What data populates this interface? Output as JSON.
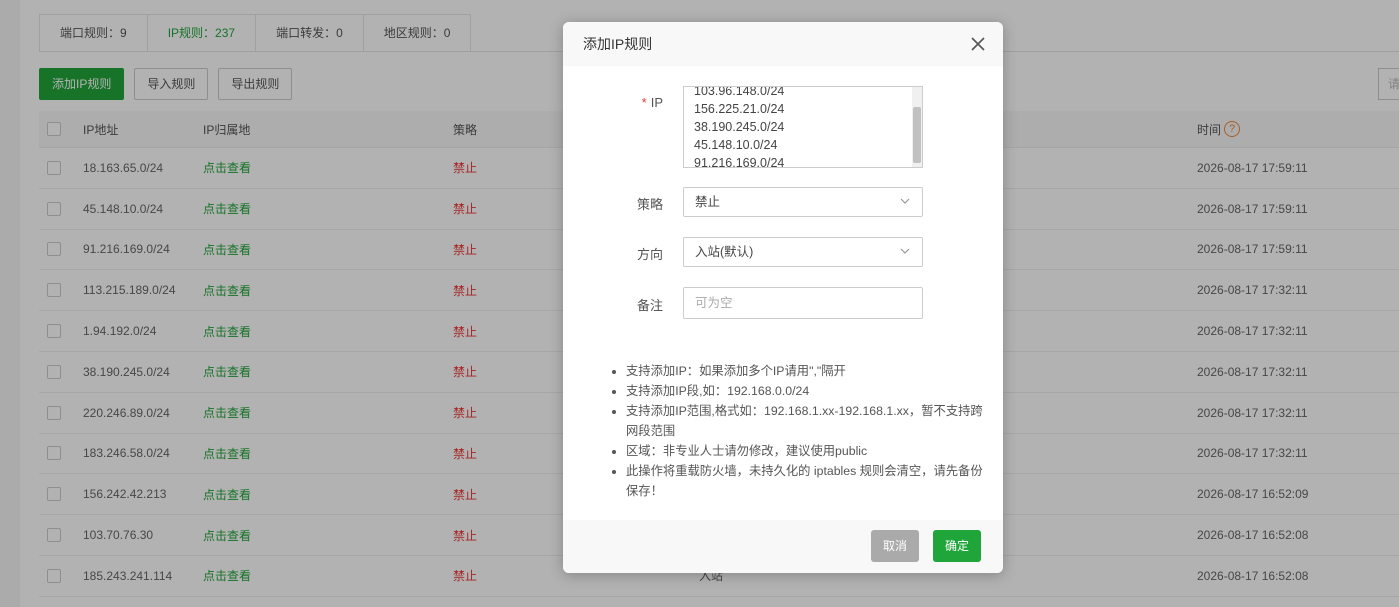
{
  "tabs": [
    {
      "label": "端口规则：9"
    },
    {
      "label": "IP规则：237"
    },
    {
      "label": "端口转发：0"
    },
    {
      "label": "地区规则：0"
    }
  ],
  "toolbar": {
    "add_label": "添加IP规则",
    "import_label": "导入规则",
    "export_label": "导出规则",
    "search_stub": "请"
  },
  "table": {
    "headers": {
      "ip": "IP地址",
      "location": "IP归属地",
      "policy": "策略",
      "time": "时间"
    },
    "rows": [
      {
        "ip": "18.163.65.0/24",
        "location": "点击查看",
        "policy": "禁止",
        "direction": "",
        "time": "2026-08-17 17:59:11"
      },
      {
        "ip": "45.148.10.0/24",
        "location": "点击查看",
        "policy": "禁止",
        "direction": "",
        "time": "2026-08-17 17:59:11"
      },
      {
        "ip": "91.216.169.0/24",
        "location": "点击查看",
        "policy": "禁止",
        "direction": "",
        "time": "2026-08-17 17:59:11"
      },
      {
        "ip": "113.215.189.0/24",
        "location": "点击查看",
        "policy": "禁止",
        "direction": "",
        "time": "2026-08-17 17:32:11"
      },
      {
        "ip": "1.94.192.0/24",
        "location": "点击查看",
        "policy": "禁止",
        "direction": "",
        "time": "2026-08-17 17:32:11"
      },
      {
        "ip": "38.190.245.0/24",
        "location": "点击查看",
        "policy": "禁止",
        "direction": "",
        "time": "2026-08-17 17:32:11"
      },
      {
        "ip": "220.246.89.0/24",
        "location": "点击查看",
        "policy": "禁止",
        "direction": "",
        "time": "2026-08-17 17:32:11"
      },
      {
        "ip": "183.246.58.0/24",
        "location": "点击查看",
        "policy": "禁止",
        "direction": "",
        "time": "2026-08-17 17:32:11"
      },
      {
        "ip": "156.242.42.213",
        "location": "点击查看",
        "policy": "禁止",
        "direction": "",
        "time": "2026-08-17 16:52:09"
      },
      {
        "ip": "103.70.76.30",
        "location": "点击查看",
        "policy": "禁止",
        "direction": "",
        "time": "2026-08-17 16:52:08"
      },
      {
        "ip": "185.243.241.114",
        "location": "点击查看",
        "policy": "禁止",
        "direction": "入站",
        "time": "2026-08-17 16:52:08"
      }
    ]
  },
  "modal": {
    "title": "添加IP规则",
    "ip_label": "IP",
    "ip_required_mark": "*",
    "ip_lines": [
      "103.96.148.0/24",
      "156.225.21.0/24",
      "38.190.245.0/24",
      "45.148.10.0/24",
      "91.216.169.0/24"
    ],
    "policy_label": "策略",
    "policy_value": "禁止",
    "direction_label": "方向",
    "direction_value": "入站(默认)",
    "note_label": "备注",
    "note_placeholder": "可为空",
    "tips": [
      "支持添加IP：如果添加多个IP请用\",\"隔开",
      "支持添加IP段,如：192.168.0.0/24",
      "支持添加IP范围,格式如：192.168.1.xx-192.168.1.xx，暂不支持跨网段范围",
      "区域：非专业人士请勿修改，建议使用public",
      "此操作将重载防火墙，未持久化的 iptables 规则会清空，请先备份保存！"
    ],
    "cancel_label": "取消",
    "ok_label": "确定"
  }
}
